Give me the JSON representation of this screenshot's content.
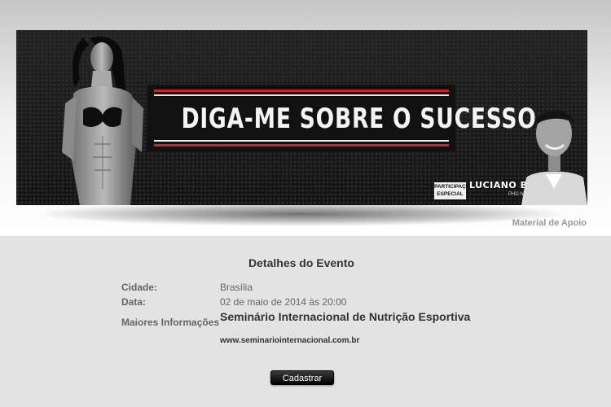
{
  "banner": {
    "title": "DIGA-ME SOBRE O SUCESSO",
    "special_tag_line1": "PARTICIPAÇÃO",
    "special_tag_line2": "ESPECIAL",
    "guest_name": "LUCIANO BRUNO",
    "guest_title": "PHD NUTRIÇÃO"
  },
  "links": {
    "material": "Material de Apoio"
  },
  "event": {
    "section_title": "Detalhes do Evento",
    "city_label": "Cidade:",
    "city_value": "Brasília",
    "date_label": "Data:",
    "date_value": "02 de maio de 2014 às 20:00",
    "more_info_label": "Maiores Informações",
    "event_name": "Seminário Internacional de Nutrição Esportiva",
    "event_url": "www.seminariointernacional.com.br"
  },
  "actions": {
    "register_label": "Cadastrar"
  },
  "colors": {
    "accent_red": "#c7262e",
    "banner_bg": "#1b1b1b",
    "page_bg": "#e3e3e3"
  }
}
